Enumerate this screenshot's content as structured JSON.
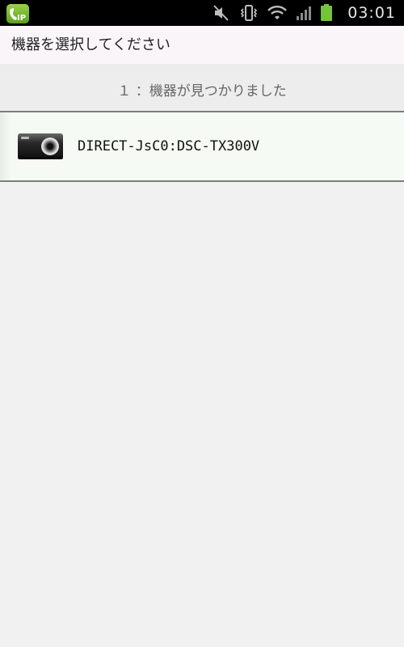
{
  "status_bar": {
    "time": "03:01",
    "app_icon_text": "IP",
    "icons": [
      "app-ip-phone-icon",
      "muted-speaker-icon",
      "vibrate-icon",
      "wifi-icon",
      "signal-icon",
      "battery-icon"
    ]
  },
  "header": {
    "title": "機器を選択してください"
  },
  "device_list": {
    "status": "１ ：機器が見つかりました",
    "items": [
      {
        "name": "DIRECT-JsC0:DSC-TX300V",
        "icon": "camera-icon"
      }
    ]
  },
  "colors": {
    "status_bar_bg": "#000000",
    "title_bg": "#f9f5f9",
    "page_bg": "#f1f1f1",
    "separator": "#7d7d7d",
    "item_bg": "#f5faf5"
  }
}
